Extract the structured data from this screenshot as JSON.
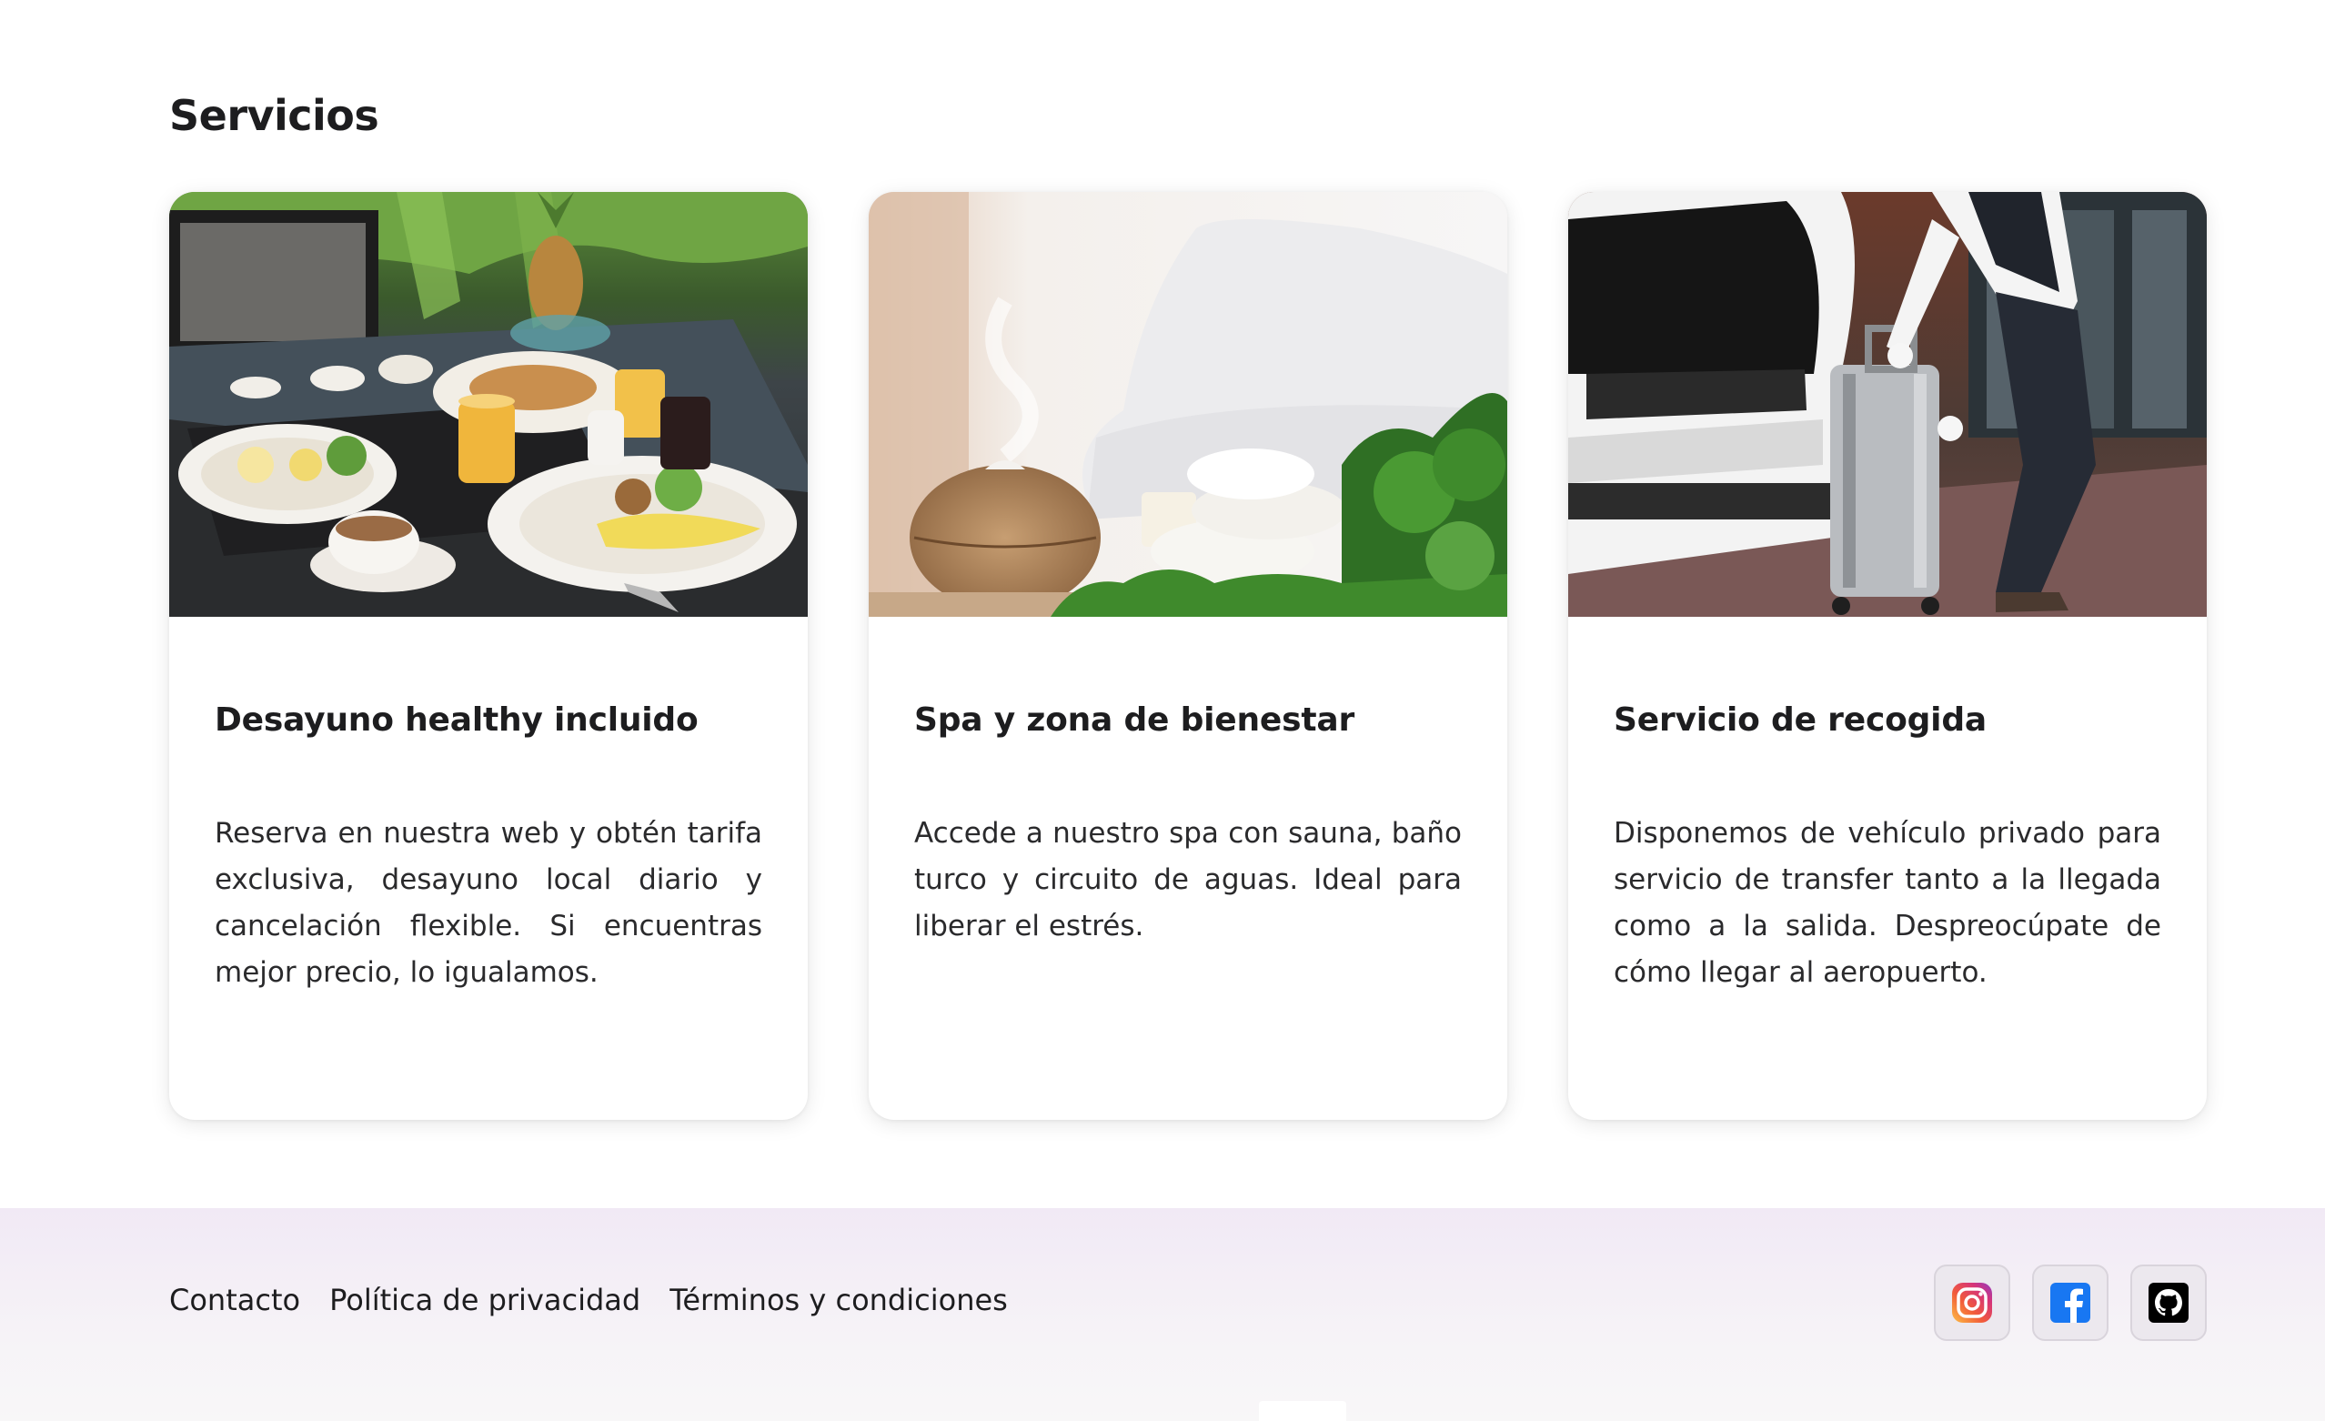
{
  "section": {
    "title": "Servicios"
  },
  "cards": [
    {
      "title": "Desayuno healthy incluido",
      "text": "Reserva en nuestra web y obtén tarifa exclusiva, desayuno local diario y cancelación flexible. Si encuentras mejor precio, lo igualamos.",
      "image_icon": "breakfast-photo"
    },
    {
      "title": "Spa y zona de bienestar",
      "text": "Accede a nuestro spa con sauna, baño turco y circuito de aguas. Ideal para liberar el estrés.",
      "image_icon": "spa-photo"
    },
    {
      "title": "Servicio de recogida",
      "text": "Disponemos de vehículo privado para servicio de transfer tanto a la llegada como a la salida. Despreocúpate de cómo llegar al aeropuerto.",
      "image_icon": "pickup-photo"
    }
  ],
  "footer": {
    "links": [
      {
        "label": "Contacto"
      },
      {
        "label": "Política de privacidad"
      },
      {
        "label": "Términos y condiciones"
      }
    ],
    "social": [
      {
        "icon": "instagram-icon"
      },
      {
        "icon": "facebook-icon"
      },
      {
        "icon": "github-icon"
      }
    ]
  },
  "colors": {
    "text": "#1d1d1f",
    "footer_bg": "#f1e9f5",
    "facebook": "#1877f2",
    "github": "#000000"
  }
}
